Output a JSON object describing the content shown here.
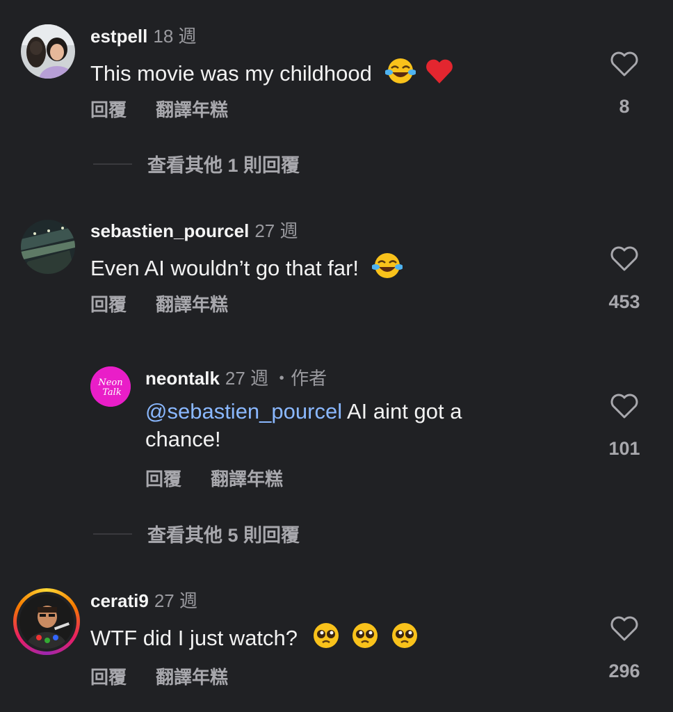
{
  "comments": [
    {
      "username": "estpell",
      "time": "18 週",
      "text": "This movie was my childhood",
      "reply_label": "回覆",
      "translate_label": "翻譯年糕",
      "likes": "8",
      "view_more": "查看其他 1 則回覆",
      "emojis": [
        "face-with-tears-of-joy",
        "red-heart"
      ]
    },
    {
      "username": "sebastien_pourcel",
      "time": "27 週",
      "text": "Even AI wouldn’t go that far!",
      "reply_label": "回覆",
      "translate_label": "翻譯年糕",
      "likes": "453",
      "emojis": [
        "face-with-tears-of-joy"
      ]
    },
    {
      "username": "neontalk",
      "time": "27 週",
      "author_badge": "・作者",
      "mention": "@sebastien_pourcel",
      "text": " AI aint got a chance!",
      "reply_label": "回覆",
      "translate_label": "翻譯年糕",
      "likes": "101",
      "view_more": "查看其他 5 則回覆",
      "avatar_text": "Neon Talk"
    },
    {
      "username": "cerati9",
      "time": "27 週",
      "text": "WTF did I just watch?",
      "reply_label": "回覆",
      "translate_label": "翻譯年糕",
      "likes": "296",
      "emojis": [
        "pleading-face",
        "pleading-face",
        "pleading-face"
      ]
    }
  ],
  "colors": {
    "background": "#202124",
    "text": "#f2f2f2",
    "secondary": "#a8a8ad",
    "mention": "#8ab8ff",
    "neon_avatar": "#e91ec8"
  }
}
